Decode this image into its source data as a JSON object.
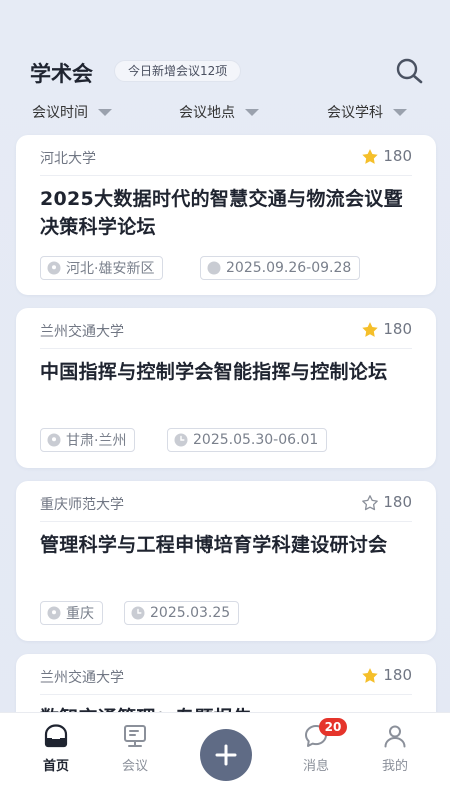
{
  "header": {
    "title": "学术会",
    "badge": "今日新增会议12项",
    "search_icon": "search-icon"
  },
  "filters": [
    {
      "label": "会议时间"
    },
    {
      "label": "会议地点"
    },
    {
      "label": "会议学科"
    }
  ],
  "cards": [
    {
      "org": "河北大学",
      "favorites": "180",
      "favorited": true,
      "title": "2025大数据时代的智慧交通与物流会议暨决策科学论坛",
      "location": "河北·雄安新区",
      "date": "2025.09.26-09.28"
    },
    {
      "org": "兰州交通大学",
      "favorites": "180",
      "favorited": true,
      "title": "中国指挥与控制学会智能指挥与控制论坛",
      "location": "甘肃·兰州",
      "date": "2025.05.30-06.01"
    },
    {
      "org": "重庆师范大学",
      "favorites": "180",
      "favorited": false,
      "title": "管理科学与工程申博培育学科建设研讨会",
      "location": "重庆",
      "date": "2025.03.25"
    },
    {
      "org": "兰州交通大学",
      "favorites": "180",
      "favorited": true,
      "title": "数智交通管理：专题报告",
      "location": "",
      "date": ""
    }
  ],
  "bottom_nav": {
    "items": [
      {
        "label": "首页",
        "icon": "home-icon",
        "active": true
      },
      {
        "label": "会议",
        "icon": "monitor-icon",
        "active": false
      },
      {
        "label": "消息",
        "icon": "chat-icon",
        "active": false,
        "badge": "20"
      },
      {
        "label": "我的",
        "icon": "user-icon",
        "active": false
      }
    ],
    "fab_icon": "plus-icon"
  },
  "colors": {
    "background": "#e6ebf5",
    "star_active": "#f5bf2a",
    "badge_red": "#e5342b",
    "fab": "#5f6b85"
  }
}
